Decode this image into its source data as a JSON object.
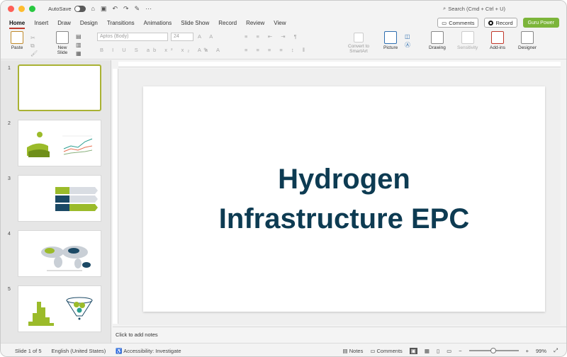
{
  "titlebar": {
    "autosave_label": "AutoSave",
    "search_placeholder": "Search (Cmd + Ctrl + U)"
  },
  "tabs": [
    {
      "label": "Home"
    },
    {
      "label": "Insert"
    },
    {
      "label": "Draw"
    },
    {
      "label": "Design"
    },
    {
      "label": "Transitions"
    },
    {
      "label": "Animations"
    },
    {
      "label": "Slide Show"
    },
    {
      "label": "Record"
    },
    {
      "label": "Review"
    },
    {
      "label": "View"
    }
  ],
  "tab_actions": {
    "comments_label": "Comments",
    "record_label": "Record",
    "guru_label": "Guru Power"
  },
  "ribbon": {
    "paste_label": "Paste",
    "new_slide_label": "New\nSlide",
    "font_name": "Aptos (Body)",
    "font_size": "24",
    "convert_label": "Convert to\nSmartArt",
    "picture_label": "Picture",
    "drawing_label": "Drawing",
    "sensitivity_label": "Sensitivity",
    "addins_label": "Add-ins",
    "designer_label": "Designer"
  },
  "thumbnails": [
    {
      "number": "1"
    },
    {
      "number": "2"
    },
    {
      "number": "3"
    },
    {
      "number": "4"
    },
    {
      "number": "5"
    }
  ],
  "slide": {
    "title_line1": "Hydrogen",
    "title_line2": "Infrastructure EPC"
  },
  "notes": {
    "placeholder": "Click to add notes"
  },
  "statusbar": {
    "slide_count": "Slide 1 of 5",
    "language": "English (United States)",
    "accessibility": "Accessibility: Investigate",
    "notes_label": "Notes",
    "comments_label": "Comments",
    "zoom": "99%"
  },
  "colors": {
    "title_color": "#0d3b52",
    "accent_green": "#7cb53a",
    "selected_thumb": "#a9b233",
    "tab_underline": "#c0382b"
  }
}
